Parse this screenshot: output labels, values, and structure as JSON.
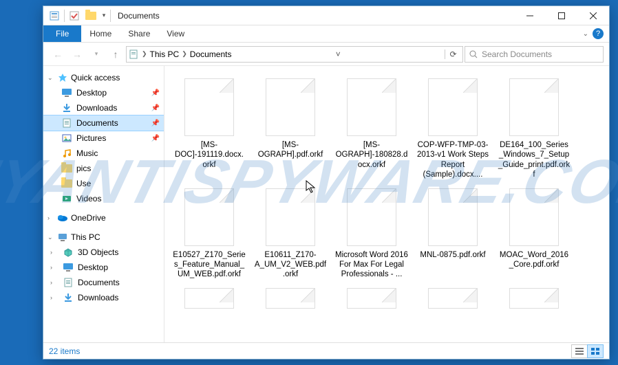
{
  "titlebar": {
    "title": "Documents"
  },
  "ribbon": {
    "file": "File",
    "tabs": [
      "Home",
      "Share",
      "View"
    ]
  },
  "address": {
    "root": "This PC",
    "current": "Documents",
    "search_placeholder": "Search Documents"
  },
  "nav": {
    "quick_access": {
      "label": "Quick access",
      "items": [
        {
          "label": "Desktop",
          "icon": "desktop",
          "pinned": true
        },
        {
          "label": "Downloads",
          "icon": "downloads",
          "pinned": true
        },
        {
          "label": "Documents",
          "icon": "documents",
          "pinned": true,
          "selected": true
        },
        {
          "label": "Pictures",
          "icon": "pictures",
          "pinned": true
        },
        {
          "label": "Music",
          "icon": "music",
          "pinned": false
        },
        {
          "label": "pics",
          "icon": "folder",
          "pinned": false
        },
        {
          "label": "Use",
          "icon": "folder",
          "pinned": false
        },
        {
          "label": "Videos",
          "icon": "videos",
          "pinned": false
        }
      ]
    },
    "onedrive": {
      "label": "OneDrive"
    },
    "this_pc": {
      "label": "This PC",
      "items": [
        {
          "label": "3D Objects",
          "icon": "3d"
        },
        {
          "label": "Desktop",
          "icon": "desktop"
        },
        {
          "label": "Documents",
          "icon": "documents"
        },
        {
          "label": "Downloads",
          "icon": "downloads"
        }
      ]
    }
  },
  "files": [
    "[MS-DOC]-191119.docx.orkf",
    "[MS-OGRAPH].pdf.orkf",
    "[MS-OGRAPH]-180828.docx.orkf",
    "COP-WFP-TMP-03-2013-v1 Work Steps Report (Sample).docx....",
    "DE164_100_Series_Windows_7_Setup_Guide_print.pdf.orkf",
    "E10527_Z170_Series_Feature_Manual_UM_WEB.pdf.orkf",
    "E10611_Z170-A_UM_V2_WEB.pdf.orkf",
    "Microsoft Word 2016 For Max For Legal Professionals - ...",
    "MNL-0875.pdf.orkf",
    "MOAC_Word_2016_Core.pdf.orkf"
  ],
  "partial_row_count": 5,
  "status": {
    "count": "22 items"
  },
  "watermark": "MYANTISPYWARE.COM"
}
